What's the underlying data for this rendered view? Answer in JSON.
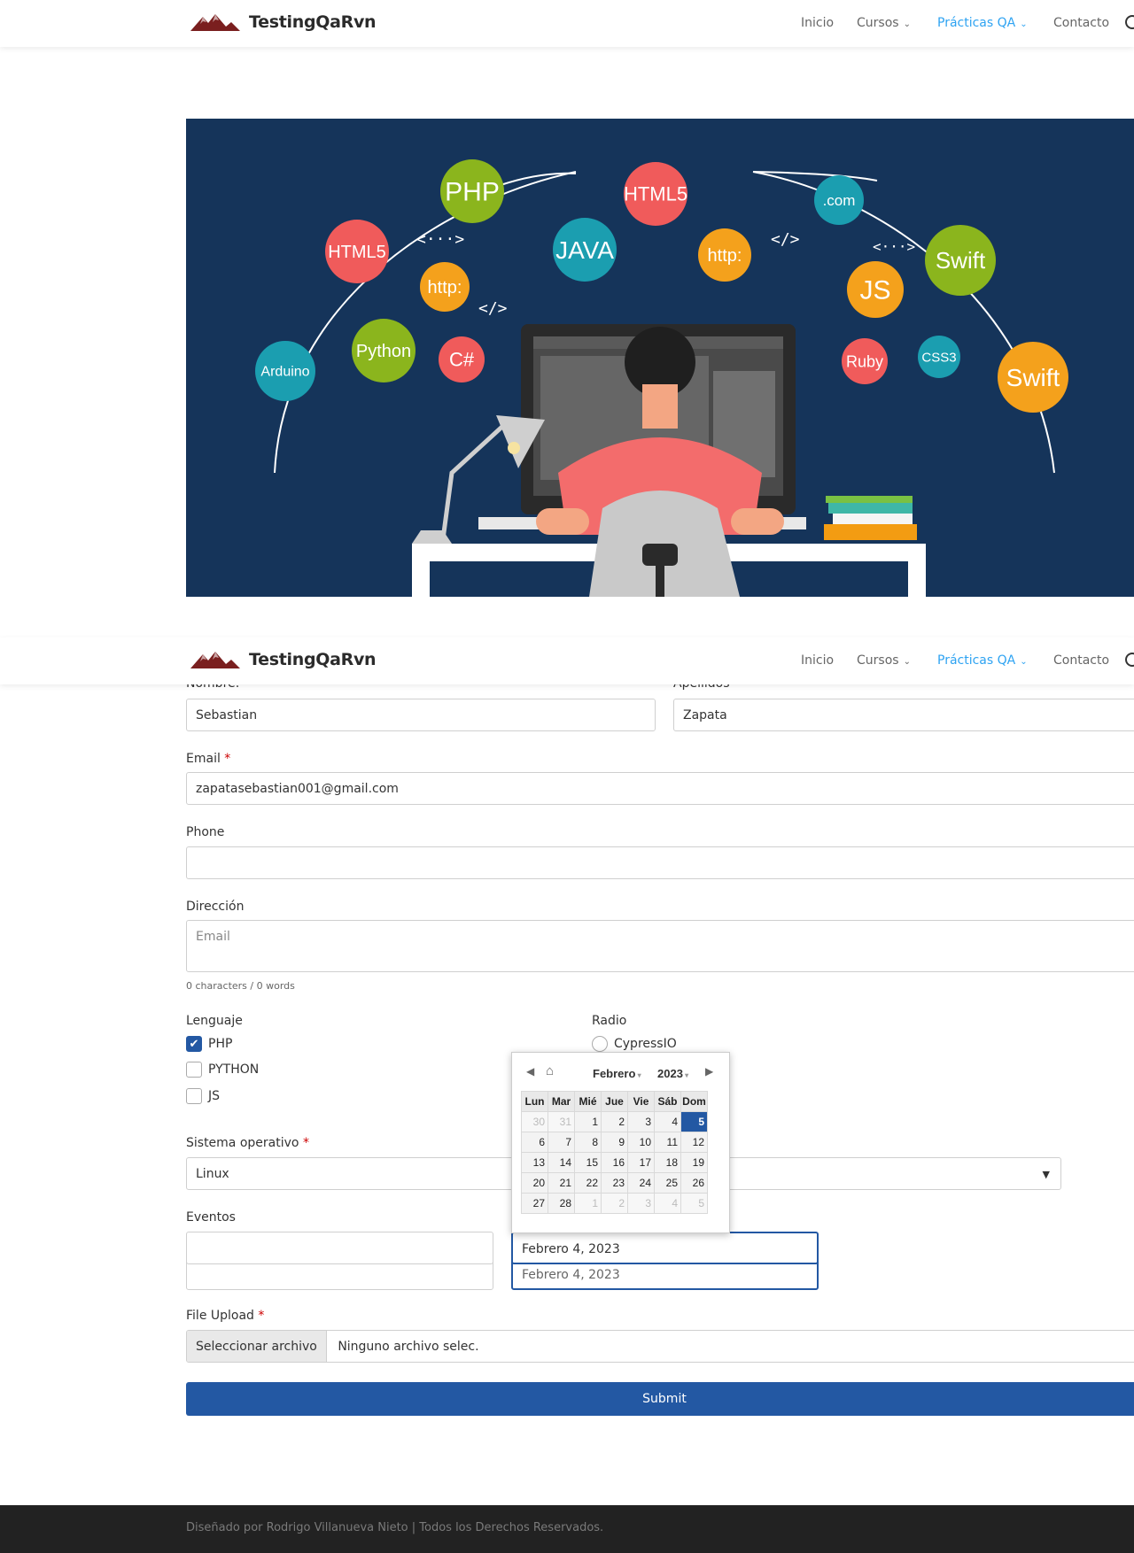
{
  "header": {
    "brand": "TestingQaRvn",
    "nav": [
      {
        "label": "Inicio"
      },
      {
        "label": "Cursos"
      },
      {
        "label": "Prácticas QA"
      },
      {
        "label": "Contacto"
      }
    ]
  },
  "hero": {
    "badges": [
      "PHP",
      "HTML5",
      "HTML5",
      ".com",
      "JAVA",
      "http:",
      "http:",
      "Swift",
      "Swift",
      "JS",
      "Arduino",
      "Python",
      "C#",
      "Ruby",
      "CSS3"
    ],
    "code_marks": [
      "<···>",
      "</>",
      "</>",
      "<···>"
    ]
  },
  "form": {
    "nombre_label": "Nombre: *",
    "nombre_value": "Sebastian",
    "apellidos_label": "Apellidos",
    "apellidos_value": "Zapata",
    "email_label": "Email",
    "email_value": "zapatasebastian001@gmail.com",
    "phone_label": "Phone",
    "phone_value": "",
    "direccion_label": "Dirección",
    "direccion_placeholder": "Email",
    "counter": "0 characters / 0 words",
    "lenguaje_label": "Lenguaje",
    "lenguajes": [
      {
        "label": "PHP",
        "checked": true
      },
      {
        "label": "PYTHON",
        "checked": false
      },
      {
        "label": "JS",
        "checked": false
      }
    ],
    "radio_label": "Radio",
    "radio_option": "CypressIO",
    "so_label": "Sistema operativo",
    "so_value": "Linux",
    "eventos_label": "Eventos",
    "evento_fecha": "Febrero 4, 2023",
    "evento_fecha_behind": "Febrero 4, 2023",
    "file_label": "File Upload",
    "file_button": "Seleccionar archivo",
    "file_status": "Ninguno archivo selec.",
    "submit": "Submit",
    "required_mark": "*"
  },
  "calendar": {
    "month": "Febrero",
    "year": "2023",
    "weekdays": [
      "Lun",
      "Mar",
      "Mié",
      "Jue",
      "Vie",
      "Sáb",
      "Dom"
    ],
    "weeks": [
      [
        "30",
        "31",
        "1",
        "2",
        "3",
        "4",
        "5"
      ],
      [
        "6",
        "7",
        "8",
        "9",
        "10",
        "11",
        "12"
      ],
      [
        "13",
        "14",
        "15",
        "16",
        "17",
        "18",
        "19"
      ],
      [
        "20",
        "21",
        "22",
        "23",
        "24",
        "25",
        "26"
      ],
      [
        "27",
        "28",
        "1",
        "2",
        "3",
        "4",
        "5"
      ]
    ],
    "selected": "5"
  },
  "footer": {
    "text": "Diseñado por Rodrigo Villanueva Nieto | Todos los Derechos Reservados."
  },
  "colors": {
    "accent": "#2ea3f2",
    "submit": "#2358a3",
    "hero_bg": "#15345a"
  }
}
